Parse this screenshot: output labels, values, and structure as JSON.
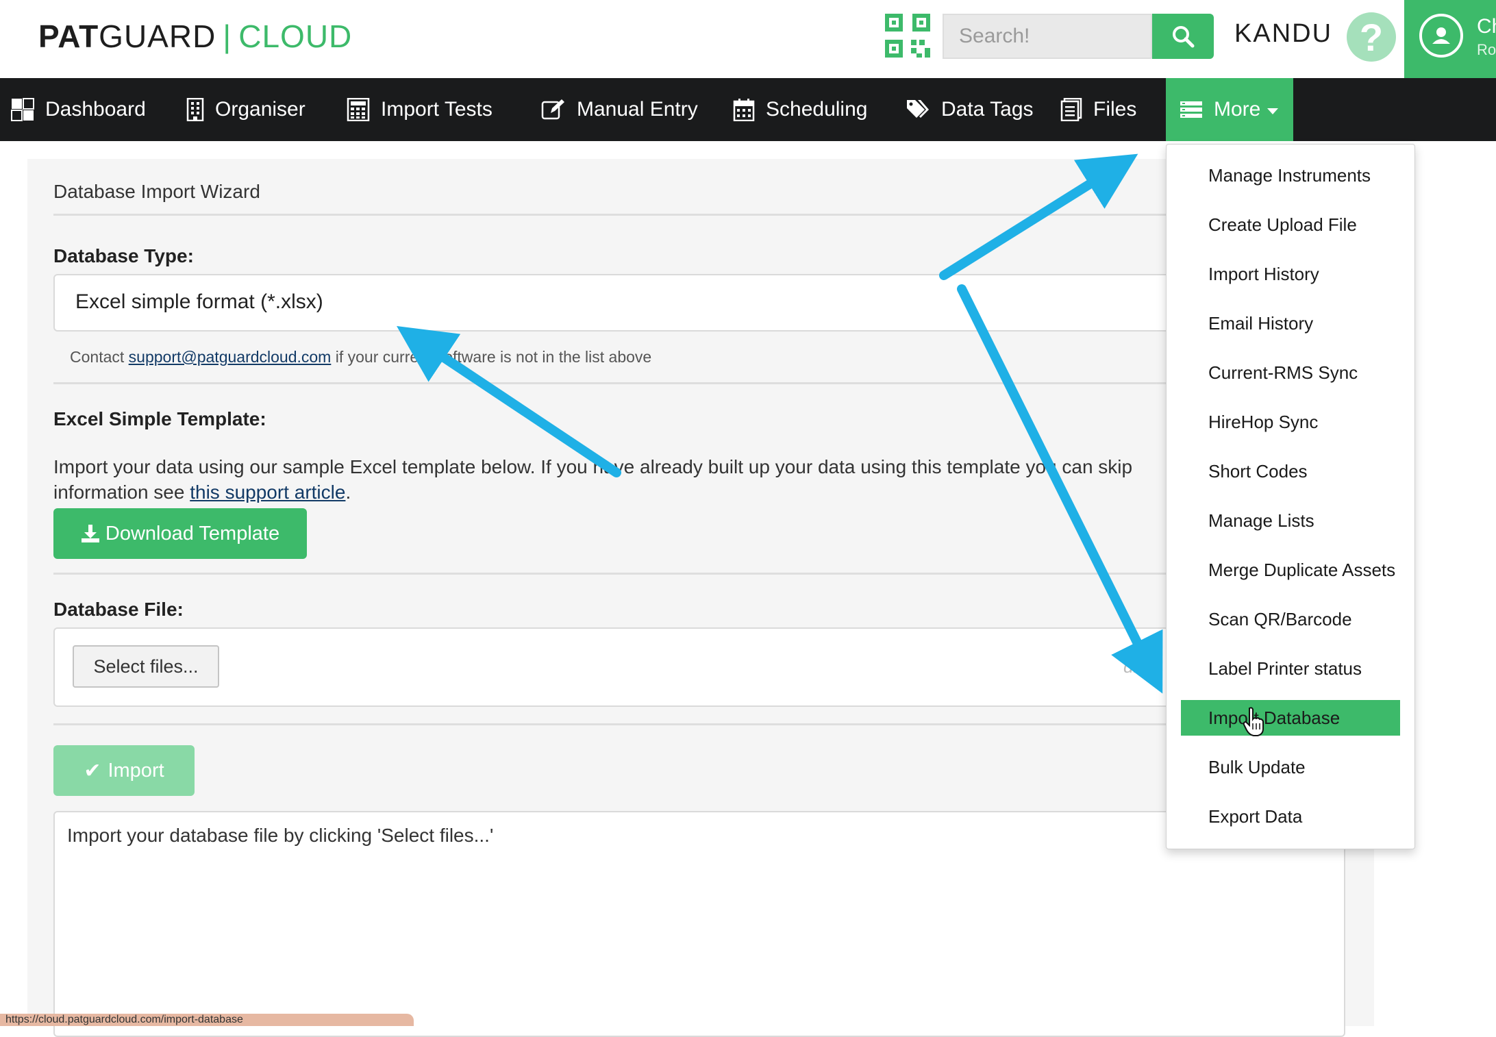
{
  "app": {
    "logo_part1": "PAT",
    "logo_part2": "GUARD",
    "logo_separator": "|",
    "logo_part3": "CLOUD",
    "brand_color": "#3dba6a"
  },
  "header": {
    "search_placeholder": "Search!",
    "org_name": "KANDU",
    "help_label": "?",
    "user_name": "Ch",
    "user_role": "Ro"
  },
  "nav": {
    "items": [
      {
        "label": "Dashboard",
        "icon": "dashboard-icon"
      },
      {
        "label": "Organiser",
        "icon": "building-icon"
      },
      {
        "label": "Import Tests",
        "icon": "calculator-icon"
      },
      {
        "label": "Manual Entry",
        "icon": "edit-icon"
      },
      {
        "label": "Scheduling",
        "icon": "calendar-icon"
      },
      {
        "label": "Data Tags",
        "icon": "tags-icon"
      },
      {
        "label": "Files",
        "icon": "file-icon"
      }
    ],
    "more_label": "More"
  },
  "main": {
    "wizard_title": "Database Import Wizard",
    "db_type_label": "Database Type:",
    "db_type_value": "Excel simple format (*.xlsx)",
    "contact_prefix": "Contact ",
    "contact_email": "support@patguardcloud.com",
    "contact_suffix": " if your current software is not in the list above",
    "template_label": "Excel Simple Template:",
    "template_desc_line1": "Import your data using our sample Excel template below. If you have already built up your data using this template you can skip",
    "template_desc_line2_prefix": "information see ",
    "template_desc_link": "this support article",
    "template_desc_line2_suffix": ".",
    "download_button": "Download Template",
    "db_file_label": "Database File:",
    "select_files_button": "Select files...",
    "drop_hint": "dr",
    "import_button": "Import",
    "log_text": "Import your database file by clicking 'Select files...'"
  },
  "status_bar": {
    "url": "https://cloud.patguardcloud.com/import-database"
  },
  "more_menu": {
    "items": [
      "Manage Instruments",
      "Create Upload File",
      "Import History",
      "Email History",
      "Current-RMS Sync",
      "HireHop Sync",
      "Short Codes",
      "Manage Lists",
      "Merge Duplicate Assets",
      "Scan QR/Barcode",
      "Label Printer status",
      "Import Database",
      "Bulk Update",
      "Export Data"
    ],
    "active_item": "Import Database"
  },
  "annotation_arrow_color": "#1fb0e6"
}
